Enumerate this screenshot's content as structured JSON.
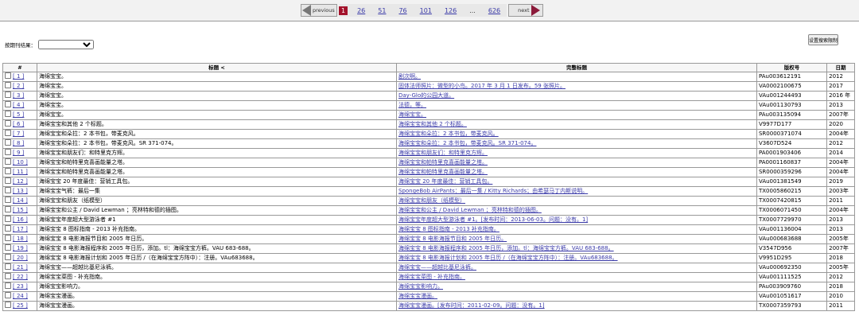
{
  "pager": {
    "previous_label": "previous",
    "next_label": "next",
    "current": "1",
    "pages": [
      "26",
      "51",
      "76",
      "101",
      "126",
      "...",
      "626"
    ]
  },
  "filter": {
    "label": "按期刊结果：",
    "selected": ""
  },
  "settings_button": "设置搜索限制",
  "table": {
    "headers": {
      "num": "#",
      "title": "标题 <",
      "full_title": "完整标题",
      "reg_number": "版权号",
      "date": "日期"
    },
    "rows": [
      {
        "num": "[ 1 ]",
        "title": "海绵宝宝。",
        "full": "剧次啊。",
        "reg": "PAu003612191",
        "date": "2012"
      },
      {
        "num": "[ 2 ]",
        "title": "海绵宝宝。",
        "full": "固体法师照片：微型的小鸟。2017 年 3 月 1 日发布。59 张照片。",
        "reg": "VA0002100675",
        "date": "2017"
      },
      {
        "num": "[ 3 ]",
        "title": "海绵宝宝。",
        "full": "Day-Glo的公园大道。",
        "reg": "VAu001244493",
        "date": "2016 年"
      },
      {
        "num": "[ 4 ]",
        "title": "海绵宝宝。",
        "full": "法德，等。",
        "reg": "VAu001130793",
        "date": "2013"
      },
      {
        "num": "[ 5 ]",
        "title": "海绵宝宝。",
        "full": "海绵宝宝。",
        "reg": "PAu003135094",
        "date": "2007年"
      },
      {
        "num": "[ 6 ]",
        "title": "海绵宝宝和其他 2 个标题。",
        "full": "海绵宝宝和其他 2 个标题。",
        "reg": "V9977D177",
        "date": "2020"
      },
      {
        "num": "[ 7 ]",
        "title": "海绵宝宝和朵拉：2 本书包，带麦克风。",
        "full": "海绵宝宝和朵拉：2 本书包，带麦克风。",
        "reg": "SR0000371074",
        "date": "2004年"
      },
      {
        "num": "[ 8 ]",
        "title": "海绵宝宝和朵拉：2 本书包，带麦克风。SR 371-074。",
        "full": "海绵宝宝和朵拉：2 本书包，带麦克风。SR 371-074。",
        "reg": "V3607D524",
        "date": "2012"
      },
      {
        "num": "[ 9 ]",
        "title": "海绵宝宝和朋友们：和特里克方辉。",
        "full": "海绵宝宝和朋友们：和特里克方辉。",
        "reg": "PA0001903406",
        "date": "2014"
      },
      {
        "num": "[ 10 ]",
        "title": "海绵宝宝和帕特里克喜画能量之塔。",
        "full": "海绵宝宝和帕特里克喜画能量之塔。",
        "reg": "PA0001160837",
        "date": "2004年"
      },
      {
        "num": "[ 11 ]",
        "title": "海绵宝宝和帕特里克喜画能量之塔。",
        "full": "海绵宝宝和帕特里克喜画能量之塔。",
        "reg": "SR0000359296",
        "date": "2004年"
      },
      {
        "num": "[ 12 ]",
        "title": "海绵宝宝 20 年度最佳：营销工具包。",
        "full": "海绵宝宝 20 年度最佳：营销工具包。",
        "reg": "VAu001381549",
        "date": "2019"
      },
      {
        "num": "[ 13 ]",
        "title": "海绵宝宝气裤：最后一集",
        "full": "SpongeBob AirPants：最后一集 / Kitty Richards；由希瑟马丁内斯说明。",
        "reg": "TX0005860215",
        "date": "2003年"
      },
      {
        "num": "[ 14 ]",
        "title": "海绵宝宝和朋友（纸模型）",
        "full": "海绵宝宝和朋友（纸模型）",
        "reg": "TX0007420815",
        "date": "2011"
      },
      {
        "num": "[ 15 ]",
        "title": "海绵宝宝和公主 / David Lewman ；亮林特和德的插图。",
        "full": "海绵宝宝和公主 / David Lewman ；亮林特和德的插图。",
        "reg": "TX0006071450",
        "date": "2004年"
      },
      {
        "num": "[ 16 ]",
        "title": "海绵宝宝年度超大型游泳者 #1",
        "full": "海绵宝宝年度超大型游泳者 #1。[发布时间：2013-06-03。问题：没有。1]",
        "reg": "TX0007729970",
        "date": "2013"
      },
      {
        "num": "[ 17 ]",
        "title": "海绵宝宝 8 图标指南 - 2013 补充指南。",
        "full": "海绵宝宝 8 图标指南 - 2013 补充指南。",
        "reg": "VAu001136004",
        "date": "2013"
      },
      {
        "num": "[ 18 ]",
        "title": "海绵宝宝 8 电影海报节目和 2005 年日历。",
        "full": "海绵宝宝 8 电影海报节目和 2005 年日历。",
        "reg": "VAu000683688",
        "date": "2005年"
      },
      {
        "num": "[ 19 ]",
        "title": "海绵宝宝 8 电影海报程序和 2005 年日历，添加。tl：海绵宝宝方裤。VAU 683-688。",
        "full": "海绵宝宝 8 电影海报程序和 2005 年日历，添加。tl：海绵宝宝方裤。VAU 683-688。",
        "reg": "V3547D956",
        "date": "2007年"
      },
      {
        "num": "[ 20 ]",
        "title": "海绵宝宝 8 电影海报计划和 2005 年日历 /（在海绵宝宝方阵中）：注册。VAu683688。",
        "full": "海绵宝宝 8 电影海报计划和 2005 年日历 /（在海绵宝宝方阵中）：注册。VAu683688。",
        "reg": "V9951D295",
        "date": "2018"
      },
      {
        "num": "[ 21 ]",
        "title": "海绵宝宝——超越比基尼泳裤。",
        "full": "海绵宝宝——超越比基尼泳裤。",
        "reg": "VAu000692350",
        "date": "2005年"
      },
      {
        "num": "[ 22 ]",
        "title": "海绵宝宝菜图 - 补充指南。",
        "full": "海绵宝宝菜图 - 补充指南。",
        "reg": "VAu001111525",
        "date": "2012"
      },
      {
        "num": "[ 23 ]",
        "title": "海绵宝宝影响力。",
        "full": "海绵宝宝影响力。",
        "reg": "PAu003909760",
        "date": "2018"
      },
      {
        "num": "[ 24 ]",
        "title": "海绵宝宝漫画。",
        "full": "海绵宝宝漫画。",
        "reg": "VAu001051617",
        "date": "2010"
      },
      {
        "num": "[ 25 ]",
        "title": "海绵宝宝漫画。",
        "full": "海绵宝宝漫画。[发布时间：2011-02-09。问题：没有。1]",
        "reg": "TX0007359793",
        "date": "2011"
      }
    ]
  }
}
